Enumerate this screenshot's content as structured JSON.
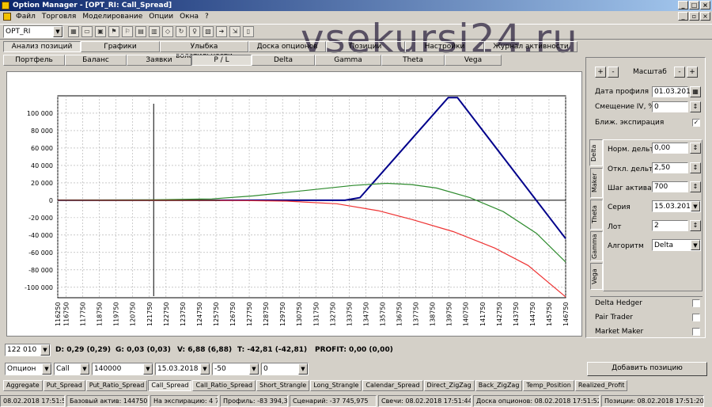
{
  "window": {
    "title": "Option Manager - [OPT_RI: Call_Spread]"
  },
  "menu": [
    "Файл",
    "Торговля",
    "Моделирование",
    "Опции",
    "Окна",
    "?"
  ],
  "toolbar": {
    "instrument": "OPT_RI",
    "icons": [
      "table-icon",
      "folder-icon",
      "save-icon",
      "flag-icon",
      "flag2-icon",
      "chart-icon",
      "grid-icon",
      "settings-icon",
      "refresh-icon",
      "bulb-icon",
      "calc-icon",
      "arrow-icon",
      "export-icon",
      "door-icon"
    ]
  },
  "top_tabs": [
    {
      "label": "Анализ позиций",
      "active": true
    },
    {
      "label": "Графики"
    },
    {
      "label": "Улыбка волатильности"
    },
    {
      "label": "Доска опционов"
    },
    {
      "label": "Позиции"
    },
    {
      "label": "Настройки"
    },
    {
      "label": "Журнал активности"
    }
  ],
  "sub_tabs": [
    {
      "label": "Портфель"
    },
    {
      "label": "Баланс"
    },
    {
      "label": "Заявки"
    },
    {
      "label": "P / L",
      "active": true
    },
    {
      "label": "Delta"
    },
    {
      "label": "Gamma"
    },
    {
      "label": "Theta"
    },
    {
      "label": "Vega"
    }
  ],
  "watermark": "vsekursi24.ru",
  "chart_data": {
    "type": "line",
    "title": "",
    "y_ticks": [
      100000,
      80000,
      60000,
      40000,
      20000,
      0,
      -20000,
      -40000,
      -60000,
      -80000,
      -100000
    ],
    "y_tick_labels": [
      "100 000",
      "80 000",
      "60 000",
      "40 000",
      "20 000",
      "0",
      "-20 000",
      "-40 000",
      "-60 000",
      "-80 000",
      "-100 000"
    ],
    "ylim": [
      -112000,
      120000
    ],
    "xlim": [
      116250,
      146750
    ],
    "x_ticks": [
      116250,
      116750,
      117750,
      118750,
      119750,
      120750,
      121750,
      122750,
      123750,
      124750,
      125750,
      126750,
      127750,
      128750,
      129750,
      130750,
      131750,
      132750,
      133750,
      134750,
      135750,
      136750,
      137750,
      138750,
      139750,
      140750,
      141750,
      142750,
      143750,
      144750,
      145750,
      146750
    ],
    "current_price_marker": 122010,
    "grid": true,
    "series": [
      {
        "color": "#00008b",
        "points": [
          [
            116250,
            0
          ],
          [
            133500,
            0
          ],
          [
            134400,
            3000
          ],
          [
            139700,
            118000
          ],
          [
            140250,
            118000
          ],
          [
            146750,
            -44000
          ]
        ]
      },
      {
        "color": "#2e8b2e",
        "points": [
          [
            116250,
            0
          ],
          [
            122000,
            500
          ],
          [
            125500,
            1500
          ],
          [
            128000,
            5000
          ],
          [
            131000,
            11000
          ],
          [
            134000,
            17000
          ],
          [
            136000,
            19500
          ],
          [
            137500,
            18000
          ],
          [
            139000,
            14000
          ],
          [
            141000,
            3000
          ],
          [
            143000,
            -13000
          ],
          [
            145000,
            -38000
          ],
          [
            146750,
            -71000
          ]
        ]
      },
      {
        "color": "#ee3333",
        "points": [
          [
            116250,
            0
          ],
          [
            127000,
            -300
          ],
          [
            130000,
            -1000
          ],
          [
            133000,
            -4000
          ],
          [
            135500,
            -12000
          ],
          [
            137500,
            -22000
          ],
          [
            140000,
            -36000
          ],
          [
            142500,
            -55000
          ],
          [
            144500,
            -75000
          ],
          [
            146750,
            -111000
          ]
        ]
      },
      {
        "color": "#7a3a1a",
        "points": [
          [
            116250,
            0
          ],
          [
            126000,
            0
          ]
        ]
      }
    ]
  },
  "side": {
    "scale_label": "Масштаб",
    "profile_date_label": "Дата профиля",
    "profile_date": "01.03.2018",
    "iv_shift_label": "Смещение IV, %",
    "iv_shift": "0",
    "near_exp_label": "Ближ. экспирация",
    "near_exp_checked": true,
    "vtabs": [
      {
        "label": "Delta",
        "active": true
      },
      {
        "label": "Maker"
      },
      {
        "label": "Theta"
      },
      {
        "label": "Gamma"
      },
      {
        "label": "Vega"
      }
    ],
    "norm_delta_label": "Норм. дельта",
    "norm_delta": "0,00",
    "dev_delta_label": "Откл. дельта",
    "dev_delta": "2,50",
    "step_label": "Шаг актива",
    "step": "700",
    "series_label": "Серия",
    "series": "15.03.2018",
    "lot_label": "Лот",
    "lot": "2",
    "algo_label": "Алгоритм",
    "algo": "Delta",
    "delta_hedger": "Delta Hedger",
    "pair_trader": "Pair Trader",
    "market_maker": "Market Maker"
  },
  "status_line": {
    "price": "122 010",
    "d": "D: 0,29  (0,29)",
    "g": "G: 0,03  (0,03)",
    "v": "V: 6,88  (6,88)",
    "t": "T: -42,81  (-42,81)",
    "profit": "PROFIT: 0,00  (0,00)"
  },
  "order": {
    "type": "Опцион",
    "kind": "Call",
    "strike": "140000",
    "date": "15.03.2018",
    "qty": "-50",
    "price": "0",
    "add_button": "Добавить позицию"
  },
  "strategy_tabs": [
    {
      "label": "Aggregate"
    },
    {
      "label": "Put_Spread"
    },
    {
      "label": "Put_Ratio_Spread"
    },
    {
      "label": "Call_Spread",
      "active": true
    },
    {
      "label": "Call_Ratio_Spread"
    },
    {
      "label": "Short_Strangle"
    },
    {
      "label": "Long_Strangle"
    },
    {
      "label": "Calendar_Spread"
    },
    {
      "label": "Direct_ZigZag"
    },
    {
      "label": "Back_ZigZag"
    },
    {
      "label": "Temp_Position"
    },
    {
      "label": "Realized_Profit"
    }
  ],
  "statusbar": [
    "08.02.2018 17:51:52",
    "Базовый актив: 144750",
    "На экспирацию: 4 750",
    "Профиль: -83 394,35",
    "Сценарий: -37 745,975",
    "Свечи: 08.02.2018 17:51:44",
    "Доска опционов: 08.02.2018 17:51:52",
    "Позиции: 08.02.2018 17:51:20"
  ]
}
